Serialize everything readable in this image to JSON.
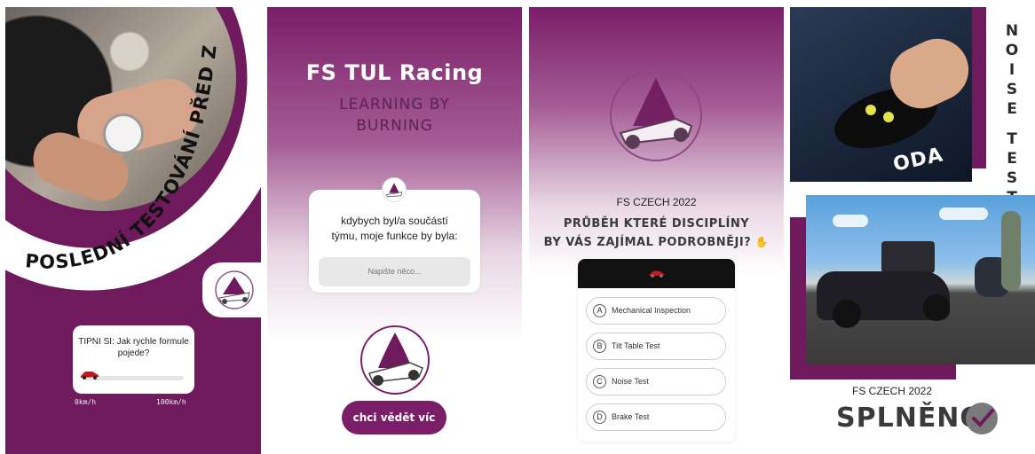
{
  "colors": {
    "brand_purple": "#6e1a5c",
    "accent": "#7a1e68"
  },
  "panel1": {
    "curved_title": "POSLEDNÍ TESTOVÁNÍ PŘED ZÁVODY",
    "quiz_question": "TIPNI SI: Jak rychle formule pojede?",
    "slider_min": "0km/h",
    "slider_max": "100km/h",
    "slider_value": 0
  },
  "panel2": {
    "brand": "FS TUL Racing",
    "slogan_line1": "LEARNING BY",
    "slogan_line2": "BURNING",
    "question_line1": "kdybych byl/a součástí",
    "question_line2": "týmu, moje funkce by byla:",
    "input_placeholder": "Napište něco...",
    "cta_label": "chci vědět víc"
  },
  "panel3": {
    "subtitle": "FS CZECH 2022",
    "headline_line1": "PRŮBĚH KTERÉ DISCIPLÍNY",
    "headline_line2": "BY VÁS ZAJÍMAL PODROBNĚJI?",
    "headline_icon": "thumbs-up-icon",
    "options": [
      {
        "letter": "A",
        "label": "Mechanical Inspection"
      },
      {
        "letter": "B",
        "label": "Tilt Table Test"
      },
      {
        "letter": "C",
        "label": "Noise Test"
      },
      {
        "letter": "D",
        "label": "Brake Test"
      }
    ]
  },
  "panel4": {
    "vertical_letters": [
      "N",
      "O",
      "I",
      "S",
      "E",
      "",
      "T",
      "E",
      "S",
      "T"
    ],
    "photo_text": "ODA",
    "caption": "FS CZECH 2022",
    "done_label": "SPLNĚNO",
    "done_icon": "checkmark-icon"
  }
}
